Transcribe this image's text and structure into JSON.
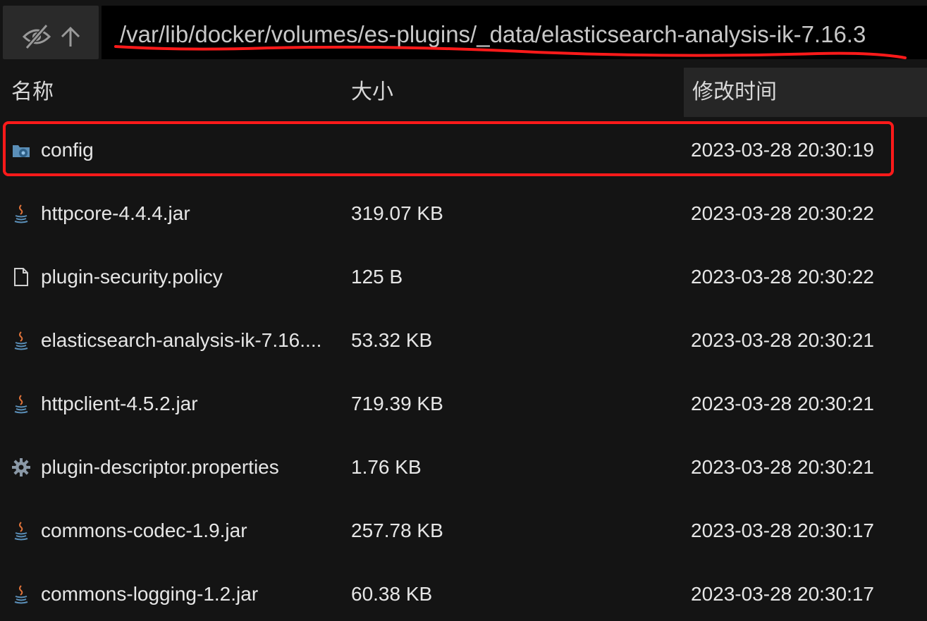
{
  "toolbar": {
    "hide_icon": "eye-slash-icon",
    "up_icon": "arrow-up-icon",
    "path": "/var/lib/docker/volumes/es-plugins/_data/elasticsearch-analysis-ik-7.16.3"
  },
  "columns": {
    "name": "名称",
    "size": "大小",
    "modified": "修改时间"
  },
  "files": [
    {
      "name": "config",
      "size": "",
      "modified": "2023-03-28 20:30:19",
      "icon": "folder-settings-icon"
    },
    {
      "name": "httpcore-4.4.4.jar",
      "size": "319.07 KB",
      "modified": "2023-03-28 20:30:22",
      "icon": "java-icon"
    },
    {
      "name": "plugin-security.policy",
      "size": "125 B",
      "modified": "2023-03-28 20:30:22",
      "icon": "file-icon"
    },
    {
      "name": "elasticsearch-analysis-ik-7.16....",
      "size": "53.32 KB",
      "modified": "2023-03-28 20:30:21",
      "icon": "java-icon"
    },
    {
      "name": "httpclient-4.5.2.jar",
      "size": "719.39 KB",
      "modified": "2023-03-28 20:30:21",
      "icon": "java-icon"
    },
    {
      "name": "plugin-descriptor.properties",
      "size": "1.76 KB",
      "modified": "2023-03-28 20:30:21",
      "icon": "gear-icon"
    },
    {
      "name": "commons-codec-1.9.jar",
      "size": "257.78 KB",
      "modified": "2023-03-28 20:30:17",
      "icon": "java-icon"
    },
    {
      "name": "commons-logging-1.2.jar",
      "size": "60.38 KB",
      "modified": "2023-03-28 20:30:17",
      "icon": "java-icon"
    }
  ],
  "annotations": {
    "highlight_color": "#ff1a1a"
  }
}
